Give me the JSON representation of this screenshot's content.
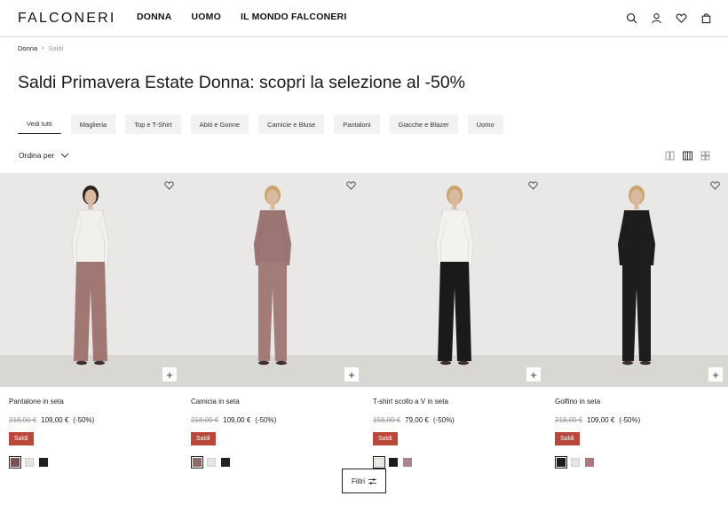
{
  "brand": "FALCONERI",
  "nav": [
    "DONNA",
    "UOMO",
    "IL MONDO FALCONERI"
  ],
  "header_icons": [
    "search-icon",
    "account-icon",
    "wishlist-icon",
    "bag-icon"
  ],
  "breadcrumb": {
    "home": "Donna",
    "separator": "›",
    "current": "Saldi"
  },
  "title": "Saldi Primavera Estate Donna: scopri la selezione al -50%",
  "categories": [
    "Vedi tutti",
    "Maglieria",
    "Top e T-Shirt",
    "Abiti e Gonne",
    "Camicie e Bluse",
    "Pantaloni",
    "Giacche e Blazer",
    "Uomo"
  ],
  "active_category": "Vedi tutti",
  "sort_label": "Ordina per",
  "view_icons": [
    "grid-2-icon",
    "grid-4-icon",
    "grid-compact-icon"
  ],
  "products": [
    {
      "name": "Pantalone in seta",
      "old_price": "218,00 €",
      "price": "109,00 €",
      "discount": "(-50%)",
      "badge": "Saldi",
      "swatches": [
        "#7a4f55",
        "#e6e4df",
        "#1e1e1e"
      ],
      "selected_swatch": 0,
      "top_color": "#f1f0ec",
      "bottom_color": "#a07772",
      "bottoms_style": "flare"
    },
    {
      "name": "Camicia in seta",
      "old_price": "218,00 €",
      "price": "109,00 €",
      "discount": "(-50%)",
      "badge": "Saldi",
      "swatches": [
        "#8c6a68",
        "#e8e6e1",
        "#222222"
      ],
      "selected_swatch": 0,
      "top_color": "#9c7674",
      "bottom_color": "#a17c78",
      "bottoms_style": "wide"
    },
    {
      "name": "T-shirt scollo a V in seta",
      "old_price": "158,00 €",
      "price": "79,00 €",
      "discount": "(-50%)",
      "badge": "Saldi",
      "swatches": [
        "#ecebe7",
        "#1c1c1c",
        "#a8858a"
      ],
      "selected_swatch": 0,
      "top_color": "#f3f2ee",
      "bottom_color": "#1a1a1a",
      "bottoms_style": "flare"
    },
    {
      "name": "Golfino in seta",
      "old_price": "218,00 €",
      "price": "109,00 €",
      "discount": "(-50%)",
      "badge": "Saldi",
      "swatches": [
        "#1c1c1c",
        "#e8e6e1",
        "#a8787c"
      ],
      "selected_swatch": 0,
      "top_color": "#1d1d1d",
      "bottom_color": "#1d1d1d",
      "bottoms_style": "wide"
    }
  ],
  "filter_label": "Filtri",
  "colors": {
    "sale_badge": "#b8483a",
    "chip_bg": "#f2f2f2"
  }
}
